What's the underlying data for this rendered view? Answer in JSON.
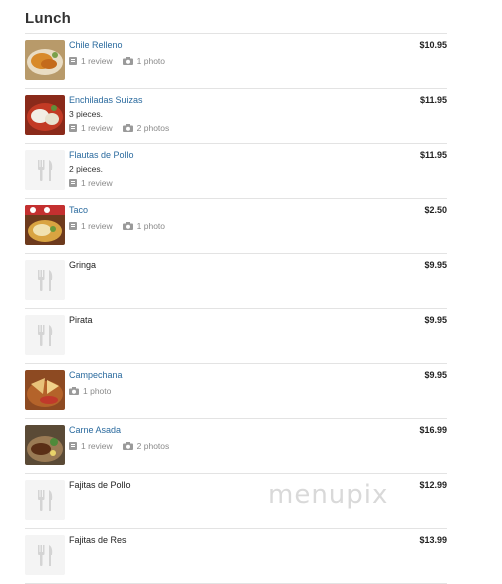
{
  "section": {
    "title": "Lunch"
  },
  "watermark": "menupix",
  "items": [
    {
      "name": "Chile Relleno",
      "desc": "",
      "price": "$10.95",
      "reviews": "1 review",
      "photos": "1 photo"
    },
    {
      "name": "Enchiladas Suizas",
      "desc": "3 pieces.",
      "price": "$11.95",
      "reviews": "1 review",
      "photos": "2 photos"
    },
    {
      "name": "Flautas de Pollo",
      "desc": "2 pieces.",
      "price": "$11.95",
      "reviews": "1 review",
      "photos": ""
    },
    {
      "name": "Taco",
      "desc": "",
      "price": "$2.50",
      "reviews": "1 review",
      "photos": "1 photo"
    },
    {
      "name": "Gringa",
      "desc": "",
      "price": "$9.95",
      "reviews": "",
      "photos": ""
    },
    {
      "name": "Pirata",
      "desc": "",
      "price": "$9.95",
      "reviews": "",
      "photos": ""
    },
    {
      "name": "Campechana",
      "desc": "",
      "price": "$9.95",
      "reviews": "",
      "photos": "1 photo"
    },
    {
      "name": "Carne Asada",
      "desc": "",
      "price": "$16.99",
      "reviews": "1 review",
      "photos": "2 photos"
    },
    {
      "name": "Fajitas de Pollo",
      "desc": "",
      "price": "$12.99",
      "reviews": "",
      "photos": ""
    },
    {
      "name": "Fajitas de Res",
      "desc": "",
      "price": "$13.99",
      "reviews": "",
      "photos": ""
    }
  ]
}
